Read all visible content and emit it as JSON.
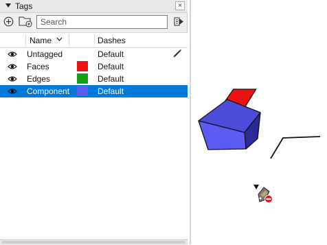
{
  "tags_panel": {
    "title": "Tags",
    "close_label": "×",
    "search": {
      "placeholder": "Search",
      "value": ""
    },
    "columns": {
      "name": "Name",
      "dashes": "Dashes"
    },
    "rows": [
      {
        "name": "Untagged",
        "color": "",
        "dashes": "Default",
        "visible": true,
        "selected": false,
        "active": true
      },
      {
        "name": "Faces",
        "color": "#ee1111",
        "dashes": "Default",
        "visible": true,
        "selected": false,
        "active": false
      },
      {
        "name": "Edges",
        "color": "#16a016",
        "dashes": "Default",
        "visible": true,
        "selected": false,
        "active": false
      },
      {
        "name": "Component",
        "color": "#5b5bf0",
        "dashes": "Default",
        "visible": true,
        "selected": true,
        "active": false
      }
    ]
  },
  "viewport": {
    "colors": {
      "red_face": "#ee1111",
      "blue_component": "#4a4ae6"
    },
    "cursor_icon": "select-not-allowed-cursor-icon"
  }
}
